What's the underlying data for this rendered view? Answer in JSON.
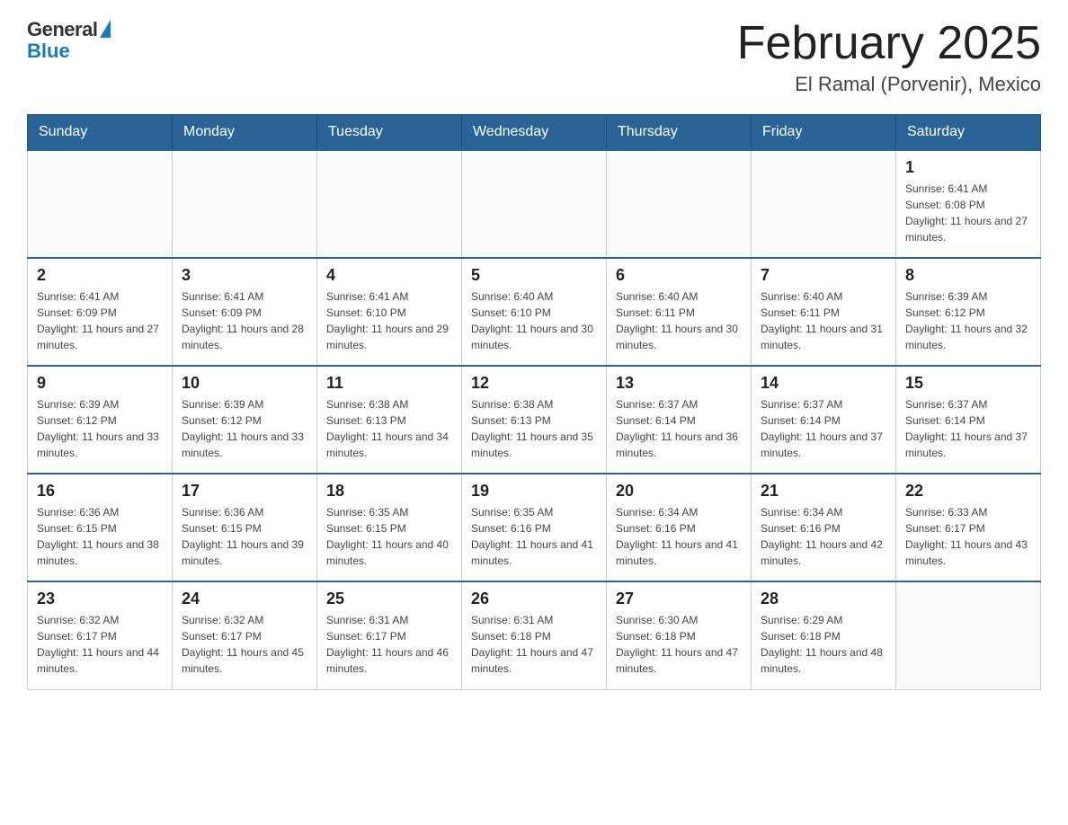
{
  "header": {
    "logo_general": "General",
    "logo_blue": "Blue",
    "month_title": "February 2025",
    "location": "El Ramal (Porvenir), Mexico"
  },
  "weekdays": [
    "Sunday",
    "Monday",
    "Tuesday",
    "Wednesday",
    "Thursday",
    "Friday",
    "Saturday"
  ],
  "weeks": [
    [
      {
        "day": "",
        "sunrise": "",
        "sunset": "",
        "daylight": ""
      },
      {
        "day": "",
        "sunrise": "",
        "sunset": "",
        "daylight": ""
      },
      {
        "day": "",
        "sunrise": "",
        "sunset": "",
        "daylight": ""
      },
      {
        "day": "",
        "sunrise": "",
        "sunset": "",
        "daylight": ""
      },
      {
        "day": "",
        "sunrise": "",
        "sunset": "",
        "daylight": ""
      },
      {
        "day": "",
        "sunrise": "",
        "sunset": "",
        "daylight": ""
      },
      {
        "day": "1",
        "sunrise": "Sunrise: 6:41 AM",
        "sunset": "Sunset: 6:08 PM",
        "daylight": "Daylight: 11 hours and 27 minutes."
      }
    ],
    [
      {
        "day": "2",
        "sunrise": "Sunrise: 6:41 AM",
        "sunset": "Sunset: 6:09 PM",
        "daylight": "Daylight: 11 hours and 27 minutes."
      },
      {
        "day": "3",
        "sunrise": "Sunrise: 6:41 AM",
        "sunset": "Sunset: 6:09 PM",
        "daylight": "Daylight: 11 hours and 28 minutes."
      },
      {
        "day": "4",
        "sunrise": "Sunrise: 6:41 AM",
        "sunset": "Sunset: 6:10 PM",
        "daylight": "Daylight: 11 hours and 29 minutes."
      },
      {
        "day": "5",
        "sunrise": "Sunrise: 6:40 AM",
        "sunset": "Sunset: 6:10 PM",
        "daylight": "Daylight: 11 hours and 30 minutes."
      },
      {
        "day": "6",
        "sunrise": "Sunrise: 6:40 AM",
        "sunset": "Sunset: 6:11 PM",
        "daylight": "Daylight: 11 hours and 30 minutes."
      },
      {
        "day": "7",
        "sunrise": "Sunrise: 6:40 AM",
        "sunset": "Sunset: 6:11 PM",
        "daylight": "Daylight: 11 hours and 31 minutes."
      },
      {
        "day": "8",
        "sunrise": "Sunrise: 6:39 AM",
        "sunset": "Sunset: 6:12 PM",
        "daylight": "Daylight: 11 hours and 32 minutes."
      }
    ],
    [
      {
        "day": "9",
        "sunrise": "Sunrise: 6:39 AM",
        "sunset": "Sunset: 6:12 PM",
        "daylight": "Daylight: 11 hours and 33 minutes."
      },
      {
        "day": "10",
        "sunrise": "Sunrise: 6:39 AM",
        "sunset": "Sunset: 6:12 PM",
        "daylight": "Daylight: 11 hours and 33 minutes."
      },
      {
        "day": "11",
        "sunrise": "Sunrise: 6:38 AM",
        "sunset": "Sunset: 6:13 PM",
        "daylight": "Daylight: 11 hours and 34 minutes."
      },
      {
        "day": "12",
        "sunrise": "Sunrise: 6:38 AM",
        "sunset": "Sunset: 6:13 PM",
        "daylight": "Daylight: 11 hours and 35 minutes."
      },
      {
        "day": "13",
        "sunrise": "Sunrise: 6:37 AM",
        "sunset": "Sunset: 6:14 PM",
        "daylight": "Daylight: 11 hours and 36 minutes."
      },
      {
        "day": "14",
        "sunrise": "Sunrise: 6:37 AM",
        "sunset": "Sunset: 6:14 PM",
        "daylight": "Daylight: 11 hours and 37 minutes."
      },
      {
        "day": "15",
        "sunrise": "Sunrise: 6:37 AM",
        "sunset": "Sunset: 6:14 PM",
        "daylight": "Daylight: 11 hours and 37 minutes."
      }
    ],
    [
      {
        "day": "16",
        "sunrise": "Sunrise: 6:36 AM",
        "sunset": "Sunset: 6:15 PM",
        "daylight": "Daylight: 11 hours and 38 minutes."
      },
      {
        "day": "17",
        "sunrise": "Sunrise: 6:36 AM",
        "sunset": "Sunset: 6:15 PM",
        "daylight": "Daylight: 11 hours and 39 minutes."
      },
      {
        "day": "18",
        "sunrise": "Sunrise: 6:35 AM",
        "sunset": "Sunset: 6:15 PM",
        "daylight": "Daylight: 11 hours and 40 minutes."
      },
      {
        "day": "19",
        "sunrise": "Sunrise: 6:35 AM",
        "sunset": "Sunset: 6:16 PM",
        "daylight": "Daylight: 11 hours and 41 minutes."
      },
      {
        "day": "20",
        "sunrise": "Sunrise: 6:34 AM",
        "sunset": "Sunset: 6:16 PM",
        "daylight": "Daylight: 11 hours and 41 minutes."
      },
      {
        "day": "21",
        "sunrise": "Sunrise: 6:34 AM",
        "sunset": "Sunset: 6:16 PM",
        "daylight": "Daylight: 11 hours and 42 minutes."
      },
      {
        "day": "22",
        "sunrise": "Sunrise: 6:33 AM",
        "sunset": "Sunset: 6:17 PM",
        "daylight": "Daylight: 11 hours and 43 minutes."
      }
    ],
    [
      {
        "day": "23",
        "sunrise": "Sunrise: 6:32 AM",
        "sunset": "Sunset: 6:17 PM",
        "daylight": "Daylight: 11 hours and 44 minutes."
      },
      {
        "day": "24",
        "sunrise": "Sunrise: 6:32 AM",
        "sunset": "Sunset: 6:17 PM",
        "daylight": "Daylight: 11 hours and 45 minutes."
      },
      {
        "day": "25",
        "sunrise": "Sunrise: 6:31 AM",
        "sunset": "Sunset: 6:17 PM",
        "daylight": "Daylight: 11 hours and 46 minutes."
      },
      {
        "day": "26",
        "sunrise": "Sunrise: 6:31 AM",
        "sunset": "Sunset: 6:18 PM",
        "daylight": "Daylight: 11 hours and 47 minutes."
      },
      {
        "day": "27",
        "sunrise": "Sunrise: 6:30 AM",
        "sunset": "Sunset: 6:18 PM",
        "daylight": "Daylight: 11 hours and 47 minutes."
      },
      {
        "day": "28",
        "sunrise": "Sunrise: 6:29 AM",
        "sunset": "Sunset: 6:18 PM",
        "daylight": "Daylight: 11 hours and 48 minutes."
      },
      {
        "day": "",
        "sunrise": "",
        "sunset": "",
        "daylight": ""
      }
    ]
  ]
}
